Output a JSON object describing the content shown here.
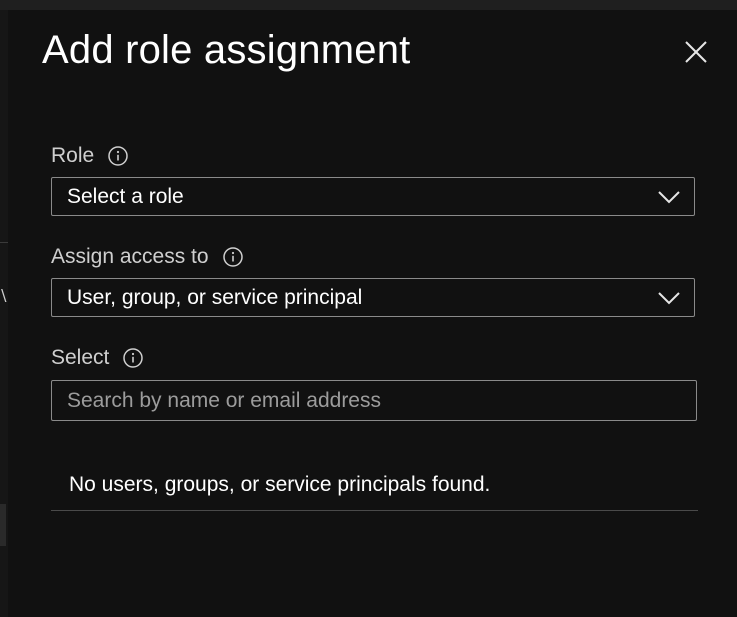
{
  "panel": {
    "title": "Add role assignment",
    "close_icon": "close-icon"
  },
  "fields": {
    "role": {
      "label": "Role",
      "value": "Select a role",
      "info_icon": "info-icon"
    },
    "assign_access": {
      "label": "Assign access to",
      "value": "User, group, or service principal",
      "info_icon": "info-icon"
    },
    "select": {
      "label": "Select",
      "placeholder": "Search by name or email address",
      "info_icon": "info-icon"
    }
  },
  "results": {
    "empty_message": "No users, groups, or service principals found."
  },
  "colors": {
    "background": "#111111",
    "border": "#8a8a8a",
    "text": "#ffffff",
    "label": "#cfcfcf",
    "placeholder": "#9c9c9c"
  }
}
